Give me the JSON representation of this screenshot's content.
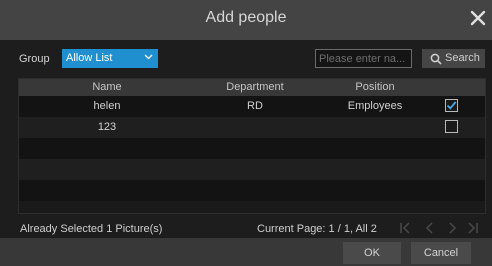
{
  "dialog": {
    "title": "Add people",
    "close_icon": "close-icon"
  },
  "filters": {
    "group_label": "Group",
    "group_value": "Allow List",
    "search_placeholder": "Please enter na...",
    "search_label": "Search"
  },
  "table": {
    "columns": [
      "Name",
      "Department",
      "Position"
    ],
    "rows": [
      {
        "name": "helen",
        "department": "RD",
        "position": "Employees",
        "checked": true
      },
      {
        "name": "123",
        "department": "",
        "position": "",
        "checked": false
      }
    ]
  },
  "status": {
    "selected_text": "Already Selected 1 Picture(s)",
    "page_text": "Current Page: 1 / 1, All 2"
  },
  "footer": {
    "ok_label": "OK",
    "cancel_label": "Cancel"
  },
  "colors": {
    "accent": "#1f8fd0",
    "checkmark": "#4aa6e6"
  }
}
